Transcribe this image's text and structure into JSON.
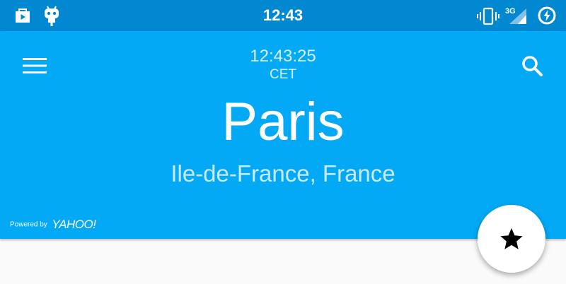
{
  "status_bar": {
    "time": "12:43",
    "network_label": "3G",
    "left_icons": [
      "play-store-icon",
      "android-robot-icon"
    ],
    "right_icons": [
      "vibrate-icon",
      "signal-3g-icon",
      "battery-saver-icon"
    ]
  },
  "toolbar": {
    "menu_icon": "hamburger-menu-icon",
    "search_icon": "search-icon"
  },
  "header": {
    "clock": "12:43:25",
    "timezone": "CET",
    "city": "Paris",
    "region": "Ile-de-France, France"
  },
  "attribution": {
    "label": "Powered by",
    "brand": "YAHOO!"
  },
  "fab": {
    "icon": "star-icon"
  },
  "colors": {
    "status_bar": "#0288d1",
    "app_bar": "#03a9f4",
    "content_background": "#fafafa",
    "fab_background": "#ffffff"
  }
}
